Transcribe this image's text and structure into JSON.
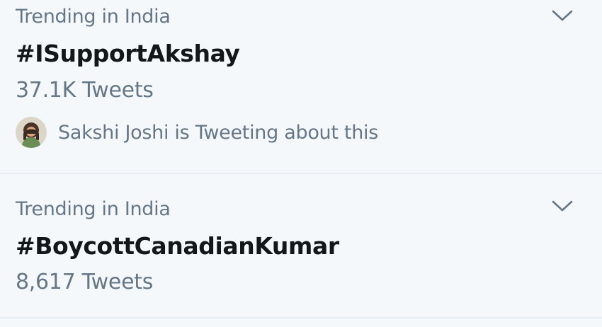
{
  "trends": [
    {
      "context": "Trending in India",
      "hashtag": "#ISupportAkshay",
      "count": "37.1K Tweets",
      "social_text": "Sakshi Joshi is Tweeting about this",
      "avatar_icon": "user-avatar"
    },
    {
      "context": "Trending in India",
      "hashtag": "#BoycottCanadianKumar",
      "count": "8,617 Tweets"
    }
  ],
  "icons": {
    "menu": "chevron-down-icon"
  },
  "colors": {
    "background": "#f5f8fa",
    "primary_text": "#14171a",
    "secondary_text": "#657786",
    "divider": "#e6ecf0"
  }
}
